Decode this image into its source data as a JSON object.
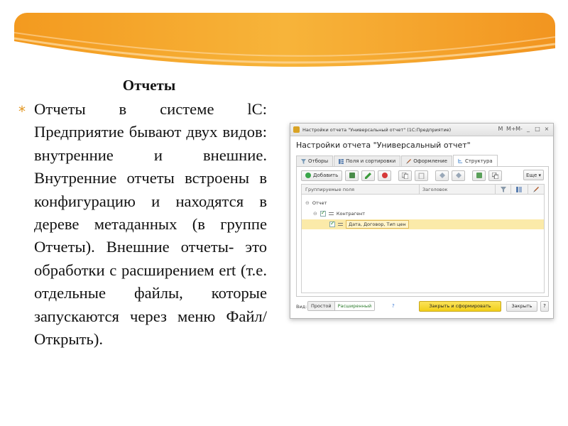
{
  "slide": {
    "title": "Отчеты",
    "bullet_symbol": "*",
    "body": "Отчеты в системе lC: Предприятие бывают двух видов: внутренние и внешние. Внутренние отчеты встроены в конфигурацию и находятся в дереве метаданных (в группе Отчеты). Внешние отчеты- это обработки с расширением ert (т.е. отдельные файлы, которые запускаются через меню Файл/Открыть).",
    "accent_color": "#e2951f"
  },
  "window": {
    "titlebar": "Настройки отчета \"Универсальный отчет\" (1С:Предприятие)",
    "controls": [
      "M",
      "M+",
      "M-",
      "_",
      "□",
      "×"
    ],
    "dialog_title": "Настройки отчета \"Универсальный отчет\"",
    "tabs": [
      {
        "label": "Отборы",
        "icon": "filter-icon"
      },
      {
        "label": "Поля и сортировки",
        "icon": "columns-icon"
      },
      {
        "label": "Оформление",
        "icon": "brush-icon"
      },
      {
        "label": "Структура",
        "icon": "structure-icon"
      }
    ],
    "toolbar": {
      "add_label": "Добавить",
      "more_label": "Еще ▾"
    },
    "grid": {
      "col_grouping": "Группируемые поля",
      "col_heading": "Заголовок",
      "rows": [
        {
          "label": "Отчет"
        },
        {
          "label": "Контрагент"
        },
        {
          "label": "Дата, Договор, Тип цен"
        }
      ]
    },
    "footer": {
      "view_label": "Вид:",
      "simple_label": "Простой",
      "extended_label": "Расширенный",
      "help_label": "?",
      "primary_label": "Закрыть и сформировать",
      "close_label": "Закрыть",
      "question_label": "?"
    }
  }
}
